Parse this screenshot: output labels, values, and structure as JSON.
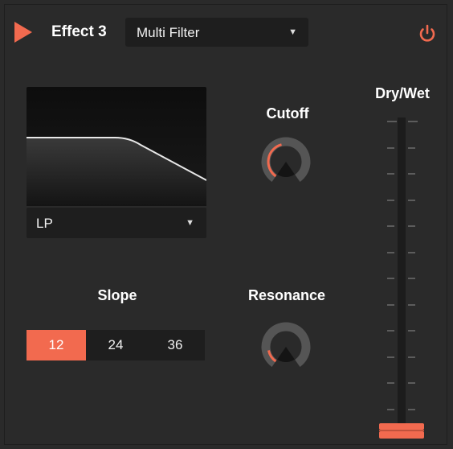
{
  "header": {
    "title": "Effect 3",
    "effect_type": "Multi Filter"
  },
  "filter": {
    "mode": "LP"
  },
  "knobs": {
    "cutoff": {
      "label": "Cutoff",
      "value": 0.45
    },
    "resonance": {
      "label": "Resonance",
      "value": 0.15
    }
  },
  "slope": {
    "label": "Slope",
    "options": [
      "12",
      "24",
      "36"
    ],
    "selected": "12"
  },
  "drywet": {
    "label": "Dry/Wet",
    "value": 0.0
  },
  "colors": {
    "accent": "#f26a4f",
    "background": "#2a2a2a",
    "field": "#1e1e1e"
  },
  "icons": {
    "play": "play-triangle-icon",
    "power": "power-icon",
    "dropdown": "chevron-down-icon"
  }
}
